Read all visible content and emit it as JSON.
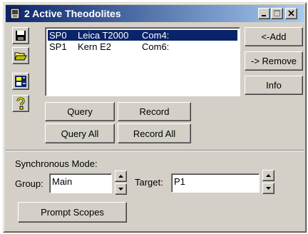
{
  "window": {
    "title": "2 Active Theodolites",
    "icons": {
      "app": "theodolite-app-icon",
      "minimize": "minimize-icon",
      "maximize": "maximize-icon",
      "close": "close-icon"
    }
  },
  "toolbar": {
    "icons": [
      "save-icon",
      "open-folder-icon",
      "select-instrument-icon",
      "help-icon"
    ]
  },
  "instruments": [
    {
      "id": "SP0",
      "name": "Leica T2000",
      "port": "Com4:",
      "selected": true
    },
    {
      "id": "SP1",
      "name": "Kern E2",
      "port": "Com6:",
      "selected": false
    }
  ],
  "actions": {
    "add": "<-Add",
    "remove": "-> Remove",
    "info": "Info",
    "query": "Query",
    "record": "Record",
    "query_all": "Query All",
    "record_all": "Record All"
  },
  "sync": {
    "heading": "Synchronous Mode:",
    "group_label": "Group:",
    "group_value": "Main",
    "target_label": "Target:",
    "target_value": "P1",
    "prompt_button": "Prompt Scopes"
  },
  "colors": {
    "face": "#d4d0c8",
    "title_start": "#0a246a",
    "title_end": "#a6caf0",
    "selection": "#0a246a"
  }
}
